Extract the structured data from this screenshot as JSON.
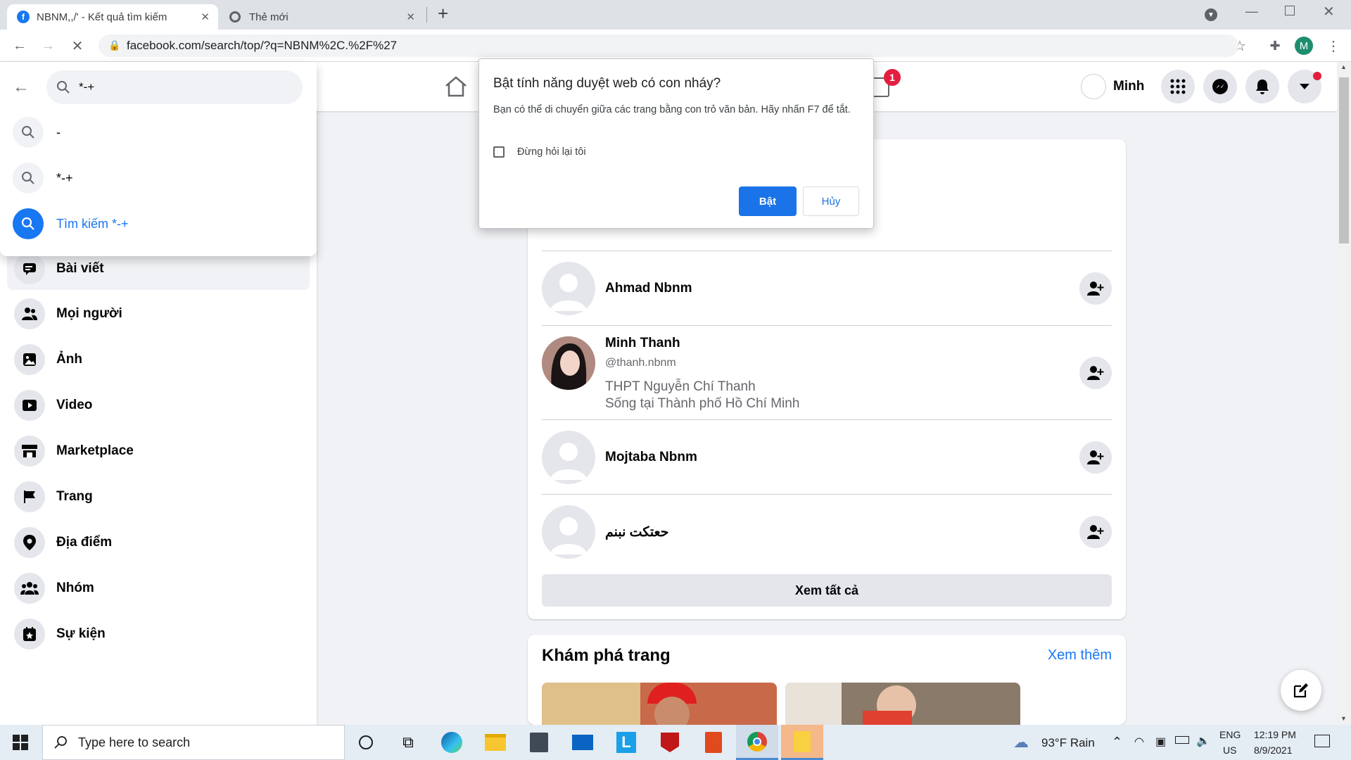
{
  "browser": {
    "tabs": [
      {
        "title": "NBNM,,/' - Kết quả tìm kiếm",
        "active": true
      },
      {
        "title": "Thẻ mới",
        "active": false
      }
    ],
    "url": "facebook.com/search/top/?q=NBNM%2C.%2F%27",
    "profile_initial": "M"
  },
  "fb_header": {
    "user_name": "Minh",
    "notification_count": "1"
  },
  "search": {
    "query": "*-+",
    "suggestions": [
      {
        "text": "-",
        "icon": "search-icon"
      },
      {
        "text": "*-+",
        "icon": "search-icon"
      },
      {
        "text": "Tìm kiếm *-+",
        "icon": "search-icon",
        "highlighted": true
      }
    ]
  },
  "sidebar": {
    "items": [
      {
        "label": "Bài viết",
        "icon": "posts-icon"
      },
      {
        "label": "Mọi người",
        "icon": "people-icon"
      },
      {
        "label": "Ảnh",
        "icon": "photos-icon"
      },
      {
        "label": "Video",
        "icon": "video-icon"
      },
      {
        "label": "Marketplace",
        "icon": "marketplace-icon"
      },
      {
        "label": "Trang",
        "icon": "flag-icon"
      },
      {
        "label": "Địa điểm",
        "icon": "location-icon"
      },
      {
        "label": "Nhóm",
        "icon": "groups-icon"
      },
      {
        "label": "Sự kiện",
        "icon": "events-icon"
      }
    ]
  },
  "results": {
    "people": [
      {
        "name": "Ahmad Nbnm"
      },
      {
        "name": "Minh Thanh",
        "handle": "@thanh.nbnm",
        "line1": "THPT Nguyễn Chí Thanh",
        "line2": "Sống tại Thành phố Hồ Chí Minh"
      },
      {
        "name": "Mojtaba Nbnm"
      },
      {
        "name": "حعتکت نبنم"
      }
    ],
    "see_all": "Xem tất cả"
  },
  "explore": {
    "title": "Khám phá trang",
    "see_more": "Xem thêm"
  },
  "dialog": {
    "title": "Bật tính năng duyệt web có con nháy?",
    "body": "Bạn có thể di chuyển giữa các trang bằng con trỏ văn bản. Hãy nhấn F7 để tắt.",
    "checkbox": "Đừng hỏi lại tôi",
    "ok": "Bật",
    "cancel": "Hủy",
    "accent": "#1a73e8"
  },
  "taskbar": {
    "search_placeholder": "Type here to search",
    "weather": "93°F  Rain",
    "lang_top": "ENG",
    "lang_bottom": "US",
    "time": "12:19 PM",
    "date": "8/9/2021"
  }
}
